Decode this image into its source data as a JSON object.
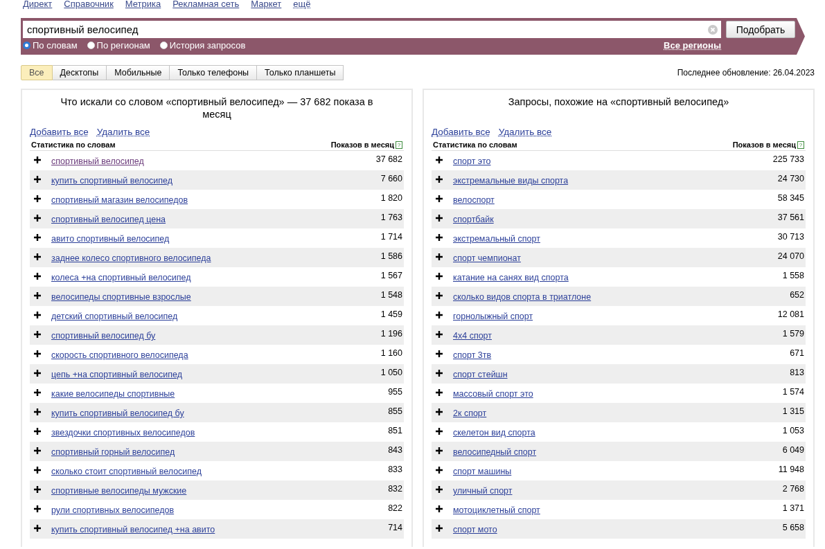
{
  "top_links": [
    "Директ",
    "Справочник",
    "Метрика",
    "Рекламная сеть",
    "Маркет"
  ],
  "more_link": "ещё",
  "search": {
    "value": "спортивный велосипед",
    "button": "Подобрать"
  },
  "modes": [
    {
      "label": "По словам",
      "selected": true
    },
    {
      "label": "По регионам",
      "selected": false
    },
    {
      "label": "История запросов",
      "selected": false
    }
  ],
  "regions_link": "Все регионы",
  "device_tabs": [
    {
      "label": "Все",
      "selected": true
    },
    {
      "label": "Десктопы",
      "selected": false
    },
    {
      "label": "Мобильные",
      "selected": false
    },
    {
      "label": "Только телефоны",
      "selected": false
    },
    {
      "label": "Только планшеты",
      "selected": false
    }
  ],
  "last_update": "Последнее обновление: 26.04.2023",
  "panels": [
    {
      "title": "Что искали со словом «спортивный велосипед» — 37 682 показа в месяц",
      "add_all": "Добавить все",
      "remove_all": "Удалить все",
      "column_1": "Статистика по словам",
      "column_2": "Показов в месяц",
      "help": "?",
      "rows": [
        {
          "phrase": "спортивный велосипед",
          "count": "37 682",
          "visited": true
        },
        {
          "phrase": "купить спортивный велосипед",
          "count": "7 660",
          "visited": false
        },
        {
          "phrase": "спортивный магазин велосипедов",
          "count": "1 820",
          "visited": false
        },
        {
          "phrase": "спортивный велосипед цена",
          "count": "1 763",
          "visited": false
        },
        {
          "phrase": "авито спортивный велосипед",
          "count": "1 714",
          "visited": false
        },
        {
          "phrase": "заднее колесо спортивного велосипеда",
          "count": "1 586",
          "visited": false
        },
        {
          "phrase": "колеса +на спортивный велосипед",
          "count": "1 567",
          "visited": false
        },
        {
          "phrase": "велосипеды спортивные взрослые",
          "count": "1 548",
          "visited": false
        },
        {
          "phrase": "детский спортивный велосипед",
          "count": "1 459",
          "visited": false
        },
        {
          "phrase": "спортивный велосипед бу",
          "count": "1 196",
          "visited": false
        },
        {
          "phrase": "скорость спортивного велосипеда",
          "count": "1 160",
          "visited": false
        },
        {
          "phrase": "цепь +на спортивный велосипед",
          "count": "1 050",
          "visited": false
        },
        {
          "phrase": "какие велосипеды спортивные",
          "count": "955",
          "visited": false
        },
        {
          "phrase": "купить спортивный велосипед бу",
          "count": "855",
          "visited": false
        },
        {
          "phrase": "звездочки спортивных велосипедов",
          "count": "851",
          "visited": false
        },
        {
          "phrase": "спортивный горный велосипед",
          "count": "843",
          "visited": false
        },
        {
          "phrase": "сколько стоит спортивный велосипед",
          "count": "833",
          "visited": false
        },
        {
          "phrase": "спортивные велосипеды мужские",
          "count": "832",
          "visited": false
        },
        {
          "phrase": "рули спортивных велосипедов",
          "count": "822",
          "visited": false
        },
        {
          "phrase": "купить спортивный велосипед +на авито",
          "count": "714",
          "visited": false
        }
      ]
    },
    {
      "title": "Запросы, похожие на «спортивный велосипед»",
      "add_all": "Добавить все",
      "remove_all": "Удалить все",
      "column_1": "Статистика по словам",
      "column_2": "Показов в месяц",
      "help": "?",
      "rows": [
        {
          "phrase": "спорт это",
          "count": "225 733",
          "visited": false
        },
        {
          "phrase": "экстремальные виды спорта",
          "count": "24 730",
          "visited": false
        },
        {
          "phrase": "велоспорт",
          "count": "58 345",
          "visited": false
        },
        {
          "phrase": "спортбайк",
          "count": "37 561",
          "visited": false
        },
        {
          "phrase": "экстремальный спорт",
          "count": "30 713",
          "visited": false
        },
        {
          "phrase": "спорт чемпионат",
          "count": "24 070",
          "visited": false
        },
        {
          "phrase": "катание на санях вид спорта",
          "count": "1 558",
          "visited": false
        },
        {
          "phrase": "сколько видов спорта в триатлоне",
          "count": "652",
          "visited": false
        },
        {
          "phrase": "горнолыжный спорт",
          "count": "12 081",
          "visited": false
        },
        {
          "phrase": "4х4 спорт",
          "count": "1 579",
          "visited": false
        },
        {
          "phrase": "спорт 3тв",
          "count": "671",
          "visited": false
        },
        {
          "phrase": "спорт стейшн",
          "count": "813",
          "visited": false
        },
        {
          "phrase": "массовый спорт это",
          "count": "1 574",
          "visited": false
        },
        {
          "phrase": "2к спорт",
          "count": "1 315",
          "visited": false
        },
        {
          "phrase": "скелетон вид спорта",
          "count": "1 053",
          "visited": false
        },
        {
          "phrase": "велосипедный спорт",
          "count": "6 049",
          "visited": false
        },
        {
          "phrase": "спорт машины",
          "count": "11 948",
          "visited": false
        },
        {
          "phrase": "уличный спорт",
          "count": "2 768",
          "visited": false
        },
        {
          "phrase": "мотоциклетный спорт",
          "count": "1 371",
          "visited": false
        },
        {
          "phrase": "спорт мото",
          "count": "5 658",
          "visited": false
        }
      ]
    }
  ]
}
